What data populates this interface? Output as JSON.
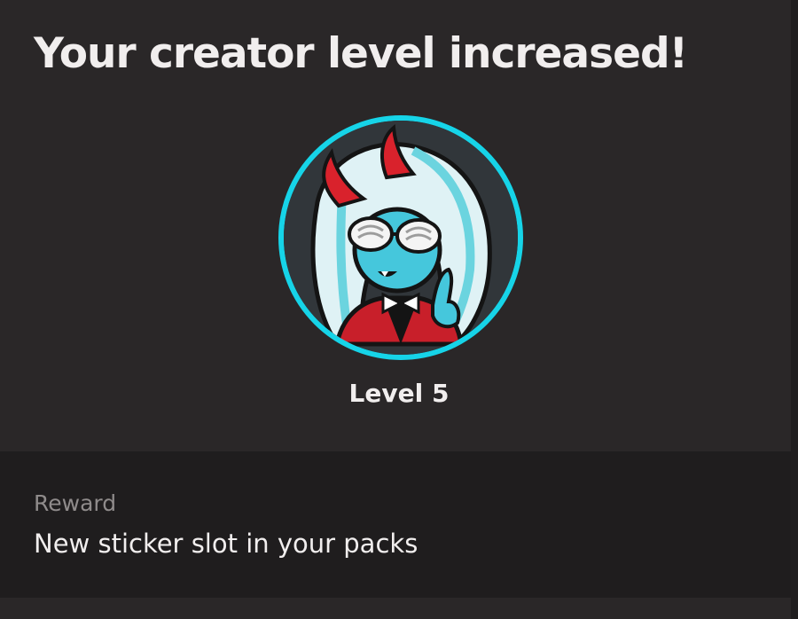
{
  "header": {
    "title": "Your creator level increased!"
  },
  "avatar": {
    "icon": "character-avatar-icon",
    "ring_color": "#16d4e8"
  },
  "level": {
    "label": "Level 5"
  },
  "reward": {
    "label": "Reward",
    "text": "New sticker slot in your packs"
  },
  "colors": {
    "background": "#2a2728",
    "panel": "#1f1d1e",
    "text": "#f1eeee",
    "muted_text": "#8f8b8b"
  }
}
